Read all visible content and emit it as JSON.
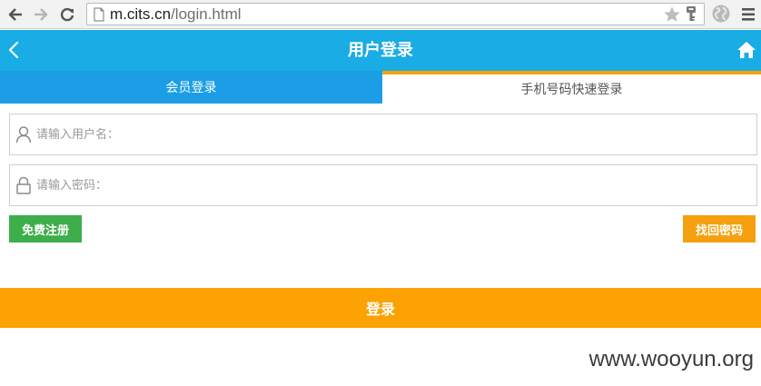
{
  "browser": {
    "url_host": "m.cits.cn",
    "url_path": "/login.html",
    "icons": [
      "back-arrow-icon",
      "forward-arrow-icon",
      "reload-icon",
      "page-icon",
      "star-icon",
      "key-icon",
      "globe-icon",
      "menu-icon"
    ]
  },
  "header": {
    "title": "用户登录",
    "color": "#1aace4"
  },
  "tabs": [
    {
      "label": "会员登录",
      "active": true
    },
    {
      "label": "手机号码快速登录",
      "active": false
    }
  ],
  "form": {
    "username_placeholder": "请输入用户名：",
    "password_placeholder": "请输入密码：",
    "username_value": "",
    "password_value": ""
  },
  "buttons": {
    "register_label": "免费注册",
    "forgot_label": "找回密码",
    "login_label": "登录"
  },
  "colors": {
    "active_tab": "#1b9ee6",
    "tab_accent": "#f7a20c",
    "register": "#3dae49",
    "forgot": "#f5a10f",
    "login": "#fca203"
  },
  "watermark": "www.wooyun.org"
}
